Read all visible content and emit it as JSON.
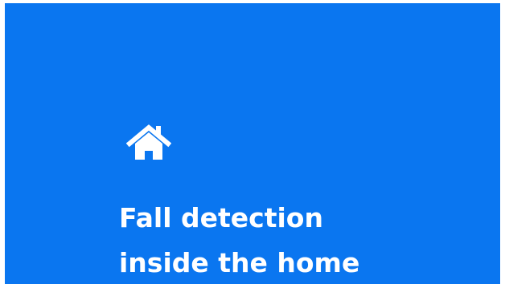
{
  "card": {
    "background_color": "#0a76f0",
    "icon": "home-icon",
    "title_line_1": "Fall detection",
    "title_line_2": "inside the home"
  }
}
